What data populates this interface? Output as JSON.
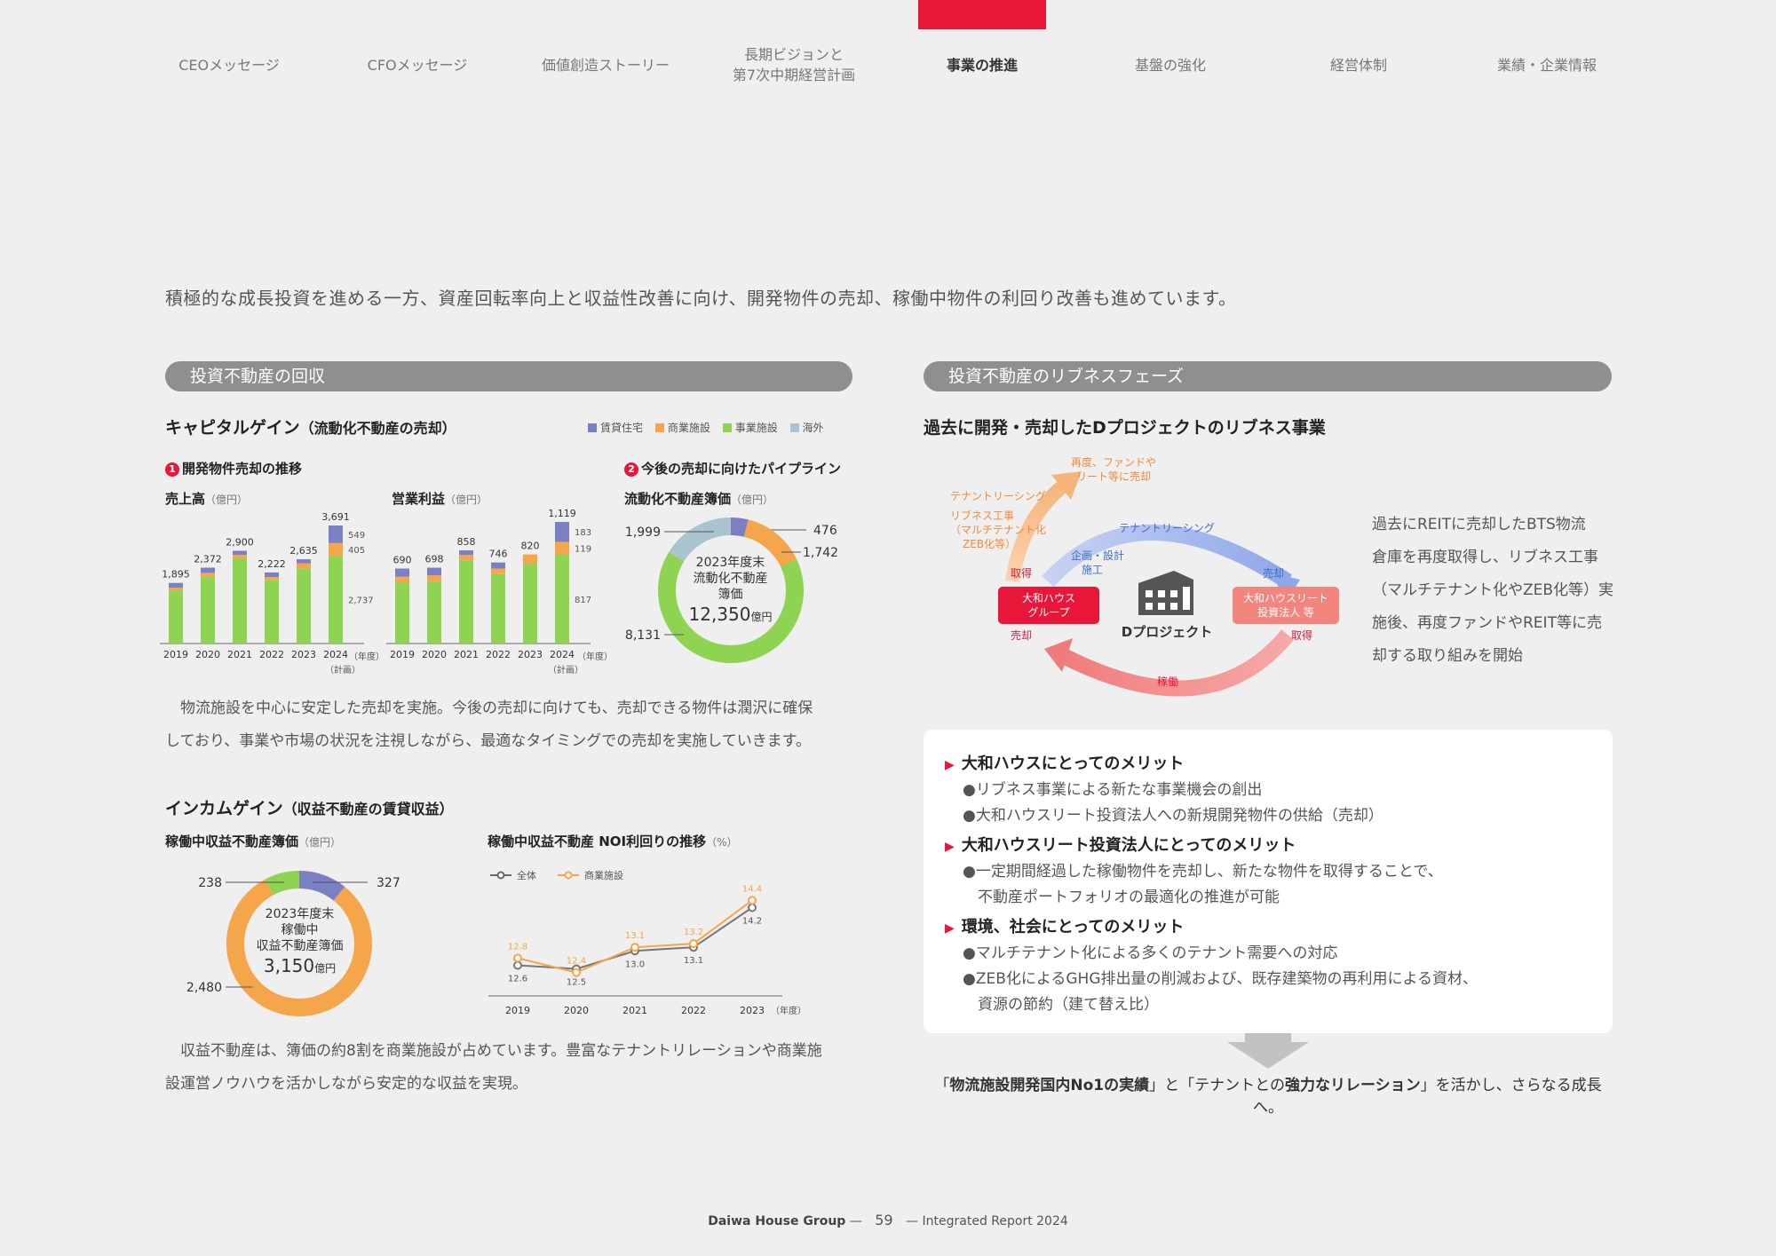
{
  "nav": {
    "items": [
      {
        "label": "CEOメッセージ"
      },
      {
        "label": "CFOメッセージ"
      },
      {
        "label": "価値創造ストーリー"
      },
      {
        "line1": "長期ビジョンと",
        "line2": "第7次中期経営計画"
      },
      {
        "label": "事業の推進"
      },
      {
        "label": "基盤の強化"
      },
      {
        "label": "経営体制"
      },
      {
        "label": "業績・企業情報"
      }
    ],
    "accent": "#e8173a"
  },
  "intro": "積極的な成長投資を進める一方、資産回転率向上と収益性改善に向け、開発物件の売却、稼働中物件の利回り改善も進めています。",
  "left": {
    "section_title": "投資不動産の回収",
    "capital": {
      "title": "キャピタルゲイン",
      "title_paren": "（流動化不動産の売却）",
      "legend": [
        {
          "label": "賃貸住宅",
          "color": "#7b7fc4"
        },
        {
          "label": "商業施設",
          "color": "#f5a54a"
        },
        {
          "label": "事業施設",
          "color": "#8ed352"
        },
        {
          "label": "海外",
          "color": "#a9c3cf"
        }
      ],
      "sub1_num": "1",
      "sub1": "開発物件売却の推移",
      "sub2_num": "2",
      "sub2": "今後の売却に向けたパイプライン",
      "sales_title": "売上高",
      "op_title": "営業利益",
      "pipe_title": "流動化不動産簿価",
      "unit": "（億円）",
      "year_unit": "（年度）",
      "plan_note": "（計画）",
      "donut_center": [
        "2023年度末",
        "流動化不動産",
        "簿価"
      ],
      "donut_total": "12,350",
      "donut_total_unit": "億円"
    },
    "capital_text": [
      "　物流施設を中心に安定した売却を実施。今後の売却に向けても、売却できる物件は潤沢に確保",
      "しており、事業や市場の状況を注視しながら、最適なタイミングでの売却を実施していきます。"
    ],
    "income": {
      "title": "インカムゲイン",
      "title_paren": "（収益不動産の賃貸収益）",
      "book_title": "稼働中収益不動産簿価",
      "unit": "（億円）",
      "noi_title": "稼働中収益不動産 NOI利回りの推移",
      "noi_unit": "（%）",
      "donut_center": [
        "2023年度末",
        "稼働中",
        "収益不動産簿価"
      ],
      "donut_total": "3,150",
      "donut_total_unit": "億円",
      "year_unit": "（年度）"
    },
    "income_text": [
      "　収益不動産は、簿価の約8割を商業施設が占めています。豊富なテナントリレーションや商業施",
      "設運営ノウハウを活かしながら安定的な収益を実現。"
    ]
  },
  "right": {
    "section_title": "投資不動産のリブネスフェーズ",
    "heading": "過去に開発・売却したDプロジェクトのリブネス事業",
    "diagram": {
      "left_box": [
        "大和ハウス",
        "グループ"
      ],
      "right_box": [
        "大和ハウスリート",
        "投資法人 等"
      ],
      "center": "Dプロジェクト",
      "top_orange": [
        "再度、ファンドや",
        "リート等に売却"
      ],
      "left_orange": [
        "テナントリーシング",
        "リブネス工事",
        "（マルチテナント化",
        "ZEB化等）"
      ],
      "acquire_left": "取得",
      "sell_left": "売却",
      "plan": [
        "企画・設計",
        "施工"
      ],
      "leasing": "テナントリーシング",
      "sell_right": "売却",
      "acquire_right": "取得",
      "operation": "稼働"
    },
    "side_text": [
      "過去にREITに売却したBTS物流",
      "倉庫を再度取得し、リブネス工事",
      "（マルチテナント化やZEB化等）実",
      "施後、再度ファンドやREIT等に売",
      "却する取り組みを開始"
    ],
    "merits": [
      {
        "title": "大和ハウスにとってのメリット",
        "items": [
          "●リブネス事業による新たな事業機会の創出",
          "●大和ハウスリート投資法人への新規開発物件の供給（売却）"
        ]
      },
      {
        "title": "大和ハウスリート投資法人にとってのメリット",
        "items": [
          "●一定期間経過した稼働物件を売却し、新たな物件を取得することで、",
          "　不動産ポートフォリオの最適化の推進が可能"
        ]
      },
      {
        "title": "環境、社会にとってのメリット",
        "items": [
          "●マルチテナント化による多くのテナント需要への対応",
          "●ZEB化によるGHG排出量の削減および、既存建築物の再利用による資材、",
          "　資源の節約（建て替え比）"
        ]
      }
    ],
    "conclusion": {
      "q1_open": "「",
      "q1_bold": "物流施設開発国内No1の実績",
      "q1_close": "」と「",
      "q2_pre": "テナントとの",
      "q2_bold": "強力なリレーション",
      "q2_close": "」を活かし、さらなる成長へ。"
    }
  },
  "footer": {
    "brand": "Daiwa House Group",
    "page": "59",
    "report": "Integrated Report 2024"
  },
  "chart_data": [
    {
      "type": "bar",
      "title": "売上高",
      "unit": "億円",
      "categories": [
        "2019",
        "2020",
        "2021",
        "2022",
        "2023",
        "2024"
      ],
      "totals": [
        1895,
        2372,
        2900,
        2222,
        2635,
        3691
      ],
      "series": [
        {
          "name": "事業施設",
          "values": [
            1650,
            2080,
            2650,
            1990,
            2340,
            2737
          ]
        },
        {
          "name": "商業施設",
          "values": [
            95,
            130,
            120,
            90,
            170,
            405
          ]
        },
        {
          "name": "賃貸住宅",
          "values": [
            150,
            162,
            130,
            142,
            125,
            549
          ]
        }
      ],
      "labels_2024": [
        "549",
        "405",
        "2,737"
      ],
      "total_labels": [
        "1,895",
        "2,372",
        "2,900",
        "2,222",
        "2,635",
        "3,691"
      ]
    },
    {
      "type": "bar",
      "title": "営業利益",
      "unit": "億円",
      "categories": [
        "2019",
        "2020",
        "2021",
        "2022",
        "2023",
        "2024"
      ],
      "totals": [
        690,
        698,
        858,
        746,
        820,
        1119
      ],
      "series": [
        {
          "name": "事業施設",
          "values": [
            560,
            570,
            765,
            640,
            735,
            817
          ]
        },
        {
          "name": "商業施設",
          "values": [
            55,
            58,
            50,
            50,
            85,
            119
          ]
        },
        {
          "name": "賃貸住宅",
          "values": [
            75,
            70,
            43,
            56,
            0,
            183
          ]
        }
      ],
      "labels_2024": [
        "183",
        "119",
        "817"
      ],
      "total_labels": [
        "690",
        "698",
        "858",
        "746",
        "820",
        "1,119"
      ]
    },
    {
      "type": "pie",
      "title": "流動化不動産簿価",
      "slices": [
        {
          "name": "賃貸住宅",
          "value": 476,
          "label": "476"
        },
        {
          "name": "商業施設",
          "value": 1742,
          "label": "1,742"
        },
        {
          "name": "事業施設",
          "value": 8131,
          "label": "8,131"
        },
        {
          "name": "海外",
          "value": 1999,
          "label": "1,999"
        }
      ]
    },
    {
      "type": "pie",
      "title": "稼働中収益不動産簿価",
      "slices": [
        {
          "name": "賃貸住宅",
          "value": 327,
          "label": "327"
        },
        {
          "name": "商業施設",
          "value": 2480,
          "label": "2,480"
        },
        {
          "name": "事業施設",
          "value": 238,
          "label": "238"
        }
      ]
    },
    {
      "type": "line",
      "title": "稼働中収益不動産 NOI利回りの推移",
      "x": [
        "2019",
        "2020",
        "2021",
        "2022",
        "2023"
      ],
      "series": [
        {
          "name": "全体",
          "values": [
            12.6,
            12.5,
            13.0,
            13.1,
            14.2
          ],
          "labels": [
            "12.6",
            "12.5",
            "13.0",
            "13.1",
            "14.2"
          ]
        },
        {
          "name": "商業施設",
          "values": [
            12.8,
            12.4,
            13.1,
            13.2,
            14.4
          ],
          "labels": [
            "12.8",
            "12.4",
            "13.1",
            "13.2",
            "14.4"
          ]
        }
      ],
      "ylim": [
        11.8,
        15.0
      ]
    }
  ]
}
